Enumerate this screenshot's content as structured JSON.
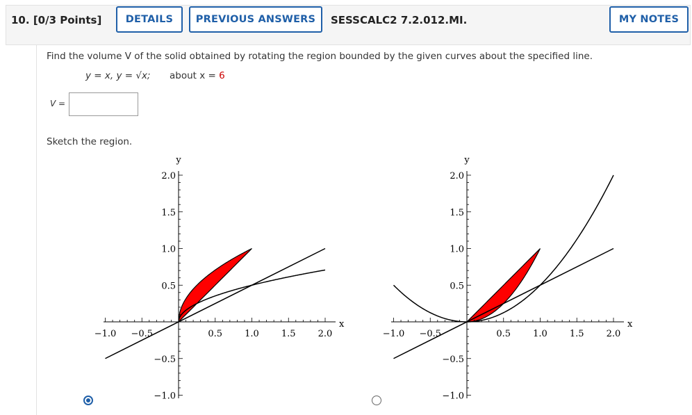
{
  "header": {
    "question_number": "10.",
    "points": "[0/3 Points]",
    "details_label": "DETAILS",
    "previous_answers_label": "PREVIOUS ANSWERS",
    "problem_code": "SESSCALC2 7.2.012.MI.",
    "my_notes_label": "MY NOTES"
  },
  "question": {
    "prompt": "Find the volume V of the solid obtained by rotating the region bounded by the given curves about the specified line.",
    "curves": "y = x, y = √x;",
    "about_label": "about x =",
    "about_value": "6",
    "answer_label": "V =",
    "answer_value": "",
    "sketch_prompt": "Sketch the region."
  },
  "graphs": [
    {
      "x_axis_label": "x",
      "y_axis_label": "y",
      "x_ticks": [
        "−1.0",
        "−0.5",
        "0.5",
        "1.0",
        "1.5",
        "2.0"
      ],
      "y_ticks": [
        "2.0",
        "1.5",
        "1.0",
        "0.5",
        "−0.5",
        "−1.0"
      ],
      "curves": [
        "y = x",
        "y = √x"
      ],
      "shaded_color": "#ff0000",
      "selected": true
    },
    {
      "x_axis_label": "x",
      "y_axis_label": "y",
      "x_ticks": [
        "−1.0",
        "−0.5",
        "0.5",
        "1.0",
        "1.5",
        "2.0"
      ],
      "y_ticks": [
        "2.0",
        "1.5",
        "1.0",
        "0.5",
        "−0.5",
        "−1.0"
      ],
      "curves": [
        "y = x",
        "y = x^2"
      ],
      "shaded_color": "#ff0000",
      "selected": false
    }
  ],
  "colors": {
    "accent": "#1f5fa8",
    "highlight": "#cc0000",
    "shade": "#ff0000"
  }
}
